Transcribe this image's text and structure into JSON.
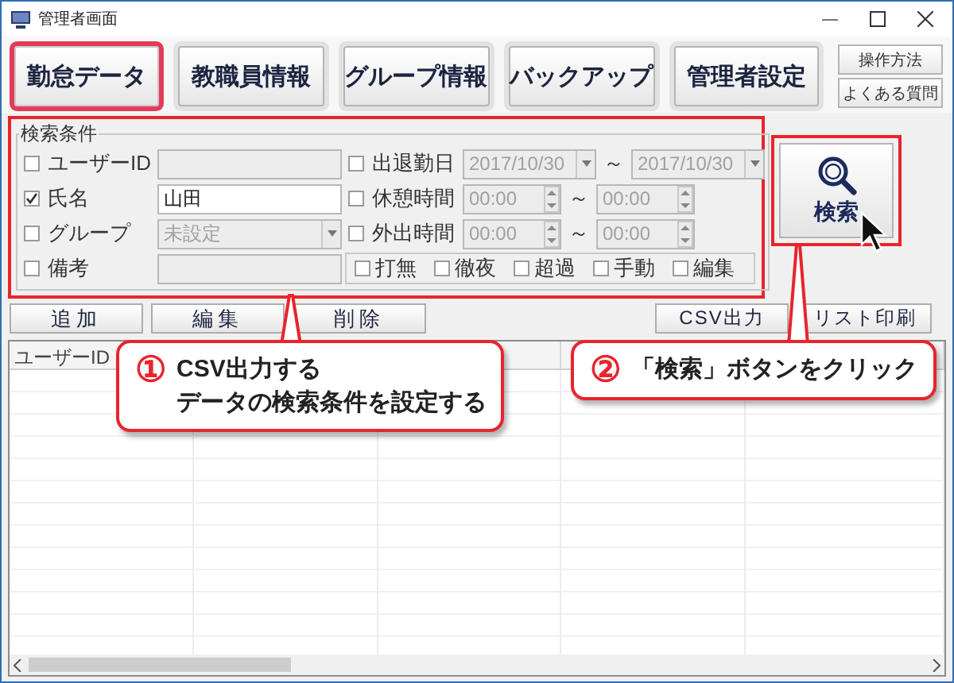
{
  "window": {
    "title": "管理者画面"
  },
  "tabs": [
    {
      "label": "勤怠データ",
      "selected": true
    },
    {
      "label": "教職員情報",
      "selected": false
    },
    {
      "label": "グループ情報",
      "selected": false
    },
    {
      "label": "バックアップ",
      "selected": false
    },
    {
      "label": "管理者設定",
      "selected": false
    }
  ],
  "help_buttons": [
    "操作方法",
    "よくある質問"
  ],
  "search_panel": {
    "legend": "検索条件",
    "highlighted": true,
    "left_fields": [
      {
        "label": "ユーザーID",
        "checked": false,
        "kind": "text",
        "disabled": true
      },
      {
        "label": "氏名",
        "checked": true,
        "kind": "text",
        "disabled": false,
        "value": "山田"
      },
      {
        "label": "グループ",
        "checked": false,
        "kind": "dropdown",
        "disabled": true,
        "value": "未設定"
      },
      {
        "label": "備考",
        "checked": false,
        "kind": "text",
        "disabled": true
      }
    ],
    "right_fields": [
      {
        "label": "出退勤日",
        "checked": false,
        "kind": "date_range",
        "disabled": true,
        "from": "2017/10/30",
        "separator": "～",
        "to": "2017/10/30"
      },
      {
        "label": "休憩時間",
        "checked": false,
        "kind": "time_range",
        "disabled": true,
        "from": "00:00",
        "separator": "～",
        "to": "00:00"
      },
      {
        "label": "外出時間",
        "checked": false,
        "kind": "time_range",
        "disabled": true,
        "from": "00:00",
        "separator": "～",
        "to": "00:00"
      }
    ],
    "flags": [
      {
        "label": "打無",
        "checked": false
      },
      {
        "label": "徹夜",
        "checked": false
      },
      {
        "label": "超過",
        "checked": false
      },
      {
        "label": "手動",
        "checked": false
      },
      {
        "label": "編集",
        "checked": false
      }
    ]
  },
  "search_button": {
    "label": "検索",
    "highlighted": true
  },
  "left_actions": [
    "追加",
    "編集",
    "削除"
  ],
  "right_actions": [
    "CSV出力",
    "リスト印刷"
  ],
  "table": {
    "columns": [
      "ユーザーID"
    ]
  },
  "callouts": [
    {
      "number": "①",
      "lines": [
        "CSV出力する",
        "データの検索条件を設定する"
      ]
    },
    {
      "number": "②",
      "lines": [
        "「検索」ボタンをクリック"
      ]
    }
  ]
}
